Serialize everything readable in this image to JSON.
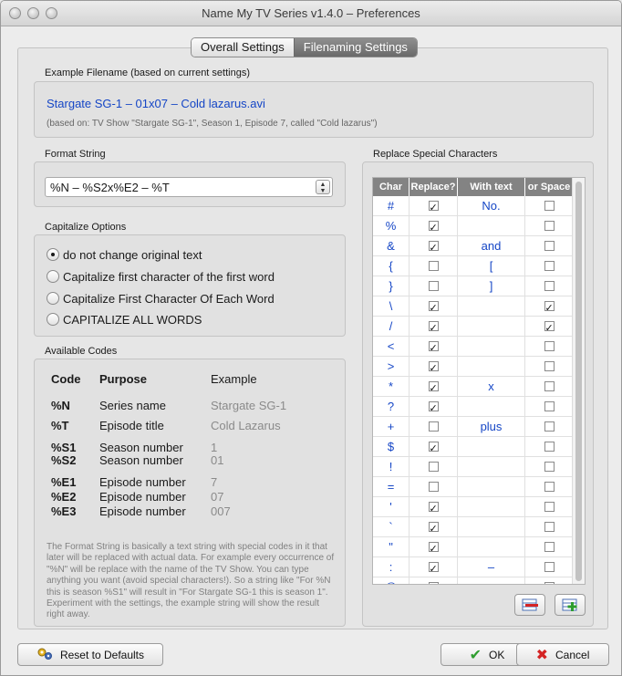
{
  "window": {
    "title": "Name My TV Series v1.4.0 – Preferences"
  },
  "tabs": [
    {
      "label": "Overall Settings",
      "active": false
    },
    {
      "label": "Filenaming Settings",
      "active": true
    }
  ],
  "example": {
    "section_label": "Example Filename (based on current settings)",
    "filename": "Stargate SG-1 – 01x07 – Cold lazarus.avi",
    "basis": "(based on: TV Show \"Stargate SG-1\", Season 1, Episode 7, called \"Cold lazarus\")"
  },
  "format": {
    "section_label": "Format String",
    "value": "%N – %S2x%E2 – %T"
  },
  "capitalize": {
    "section_label": "Capitalize Options",
    "options": [
      {
        "label": "do not change original text",
        "checked": true
      },
      {
        "label": "Capitalize first character of the first word",
        "checked": false
      },
      {
        "label": "Capitalize First Character Of Each Word",
        "checked": false
      },
      {
        "label": "CAPITALIZE ALL WORDS",
        "checked": false
      }
    ]
  },
  "codes": {
    "section_label": "Available Codes",
    "headers": {
      "code": "Code",
      "purpose": "Purpose",
      "example": "Example"
    },
    "rows": [
      {
        "code": "%N",
        "purpose": "Series name",
        "example": "Stargate SG-1"
      },
      {
        "code": "%T",
        "purpose": "Episode title",
        "example": "Cold Lazarus"
      },
      {
        "code": "%S1",
        "purpose": "Season number",
        "example": "1"
      },
      {
        "code": "%S2",
        "purpose": "Season number",
        "example": "01"
      },
      {
        "code": "%E1",
        "purpose": "Episode number",
        "example": "7"
      },
      {
        "code": "%E2",
        "purpose": "Episode number",
        "example": "07"
      },
      {
        "code": "%E3",
        "purpose": "Episode number",
        "example": "007"
      }
    ],
    "help": "The Format String is basically a text string with special codes in it that later will be replaced with actual data. For example every occurrence of \"%N\" will be replace with the name of the TV Show. You can type anything you want (avoid special characters!). So a string like \"For %N this is season %S1\" will result in \"For Stargate SG-1 this is season 1\". Experiment with the settings, the example string will show the result right away."
  },
  "replace": {
    "section_label": "Replace Special Characters",
    "headers": {
      "char": "Char",
      "replace": "Replace?",
      "with": "With text",
      "space": "or Space"
    },
    "rows": [
      {
        "char": "#",
        "replace": true,
        "with": "No.",
        "space": false
      },
      {
        "char": "%",
        "replace": true,
        "with": "",
        "space": false
      },
      {
        "char": "&",
        "replace": true,
        "with": "and",
        "space": false
      },
      {
        "char": "{",
        "replace": false,
        "with": "[",
        "space": false
      },
      {
        "char": "}",
        "replace": false,
        "with": "]",
        "space": false
      },
      {
        "char": "\\",
        "replace": true,
        "with": "",
        "space": true
      },
      {
        "char": "/",
        "replace": true,
        "with": "",
        "space": true
      },
      {
        "char": "<",
        "replace": true,
        "with": "",
        "space": false
      },
      {
        "char": ">",
        "replace": true,
        "with": "",
        "space": false
      },
      {
        "char": "*",
        "replace": true,
        "with": "x",
        "space": false
      },
      {
        "char": "?",
        "replace": true,
        "with": "",
        "space": false
      },
      {
        "char": "+",
        "replace": false,
        "with": "plus",
        "space": false
      },
      {
        "char": "$",
        "replace": true,
        "with": "",
        "space": false
      },
      {
        "char": "!",
        "replace": false,
        "with": "",
        "space": false
      },
      {
        "char": "=",
        "replace": false,
        "with": "",
        "space": false
      },
      {
        "char": "'",
        "replace": true,
        "with": "",
        "space": false
      },
      {
        "char": "`",
        "replace": true,
        "with": "",
        "space": false
      },
      {
        "char": "\"",
        "replace": true,
        "with": "",
        "space": false
      },
      {
        "char": ":",
        "replace": true,
        "with": "–",
        "space": false
      },
      {
        "char": "@",
        "replace": false,
        "with": "",
        "space": false
      }
    ]
  },
  "buttons": {
    "reset": "Reset to Defaults",
    "ok": "OK",
    "cancel": "Cancel"
  },
  "colors": {
    "link_blue": "#1546c6",
    "header_gray": "#838383",
    "ok_green": "#2e9d2e",
    "cancel_red": "#d42424"
  }
}
